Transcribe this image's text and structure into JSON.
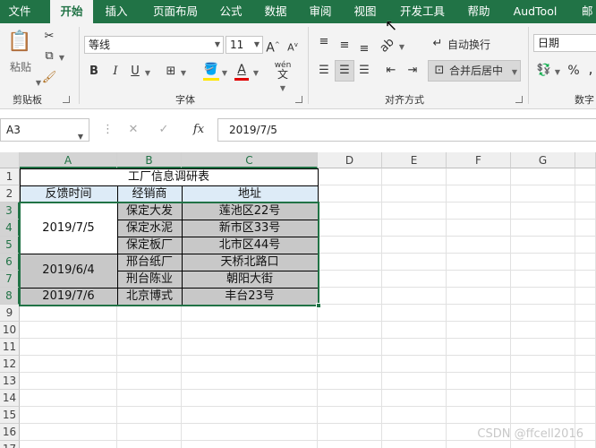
{
  "tabs": [
    {
      "label": "文件"
    },
    {
      "label": "开始"
    },
    {
      "label": "插入"
    },
    {
      "label": "页面布局"
    },
    {
      "label": "公式"
    },
    {
      "label": "数据"
    },
    {
      "label": "审阅"
    },
    {
      "label": "视图"
    },
    {
      "label": "开发工具"
    },
    {
      "label": "帮助"
    },
    {
      "label": "AudTool"
    },
    {
      "label": "邮"
    }
  ],
  "ribbon": {
    "clipboard": {
      "paste_label": "粘贴",
      "group_label": "剪贴板"
    },
    "font": {
      "name": "等线",
      "size": "11",
      "bold": "B",
      "italic": "I",
      "underline": "U",
      "grow": "A",
      "shrink": "A",
      "wen": "wén",
      "group_label": "字体",
      "font_color": "#e00000"
    },
    "alignment": {
      "wrap_label": "自动换行",
      "merge_label": "合并后居中",
      "group_label": "对齐方式"
    },
    "number": {
      "format": "日期",
      "percent": "%",
      "group_label": "数字"
    }
  },
  "formula_bar": {
    "cell_ref": "A3",
    "fx": "fx",
    "value": "2019/7/5"
  },
  "columns": [
    "A",
    "B",
    "C",
    "D",
    "E",
    "F",
    "G"
  ],
  "rows": [
    "1",
    "2",
    "3",
    "4",
    "5",
    "6",
    "7",
    "8",
    "9",
    "10",
    "11",
    "12",
    "13",
    "14",
    "15",
    "16",
    "17"
  ],
  "table": {
    "title": "工厂信息调研表",
    "headers": [
      "反馈时间",
      "经销商",
      "地址"
    ],
    "groups": [
      {
        "date": "2019/7/5",
        "rows": [
          [
            "保定大发",
            "莲池区22号"
          ],
          [
            "保定水泥",
            "新市区33号"
          ],
          [
            "保定板厂",
            "北市区44号"
          ]
        ]
      },
      {
        "date": "2019/6/4",
        "rows": [
          [
            "邢台纸厂",
            "天桥北路口"
          ],
          [
            "刑台陈业",
            "朝阳大街"
          ]
        ]
      },
      {
        "date": "2019/7/6",
        "rows": [
          [
            "北京博式",
            "丰台23号"
          ]
        ]
      }
    ]
  },
  "colors": {
    "accent": "#217346",
    "header_fill": "#ddebf7",
    "gray_fill": "#c8c8c8"
  },
  "watermark": "CSDN @ffcell2016"
}
